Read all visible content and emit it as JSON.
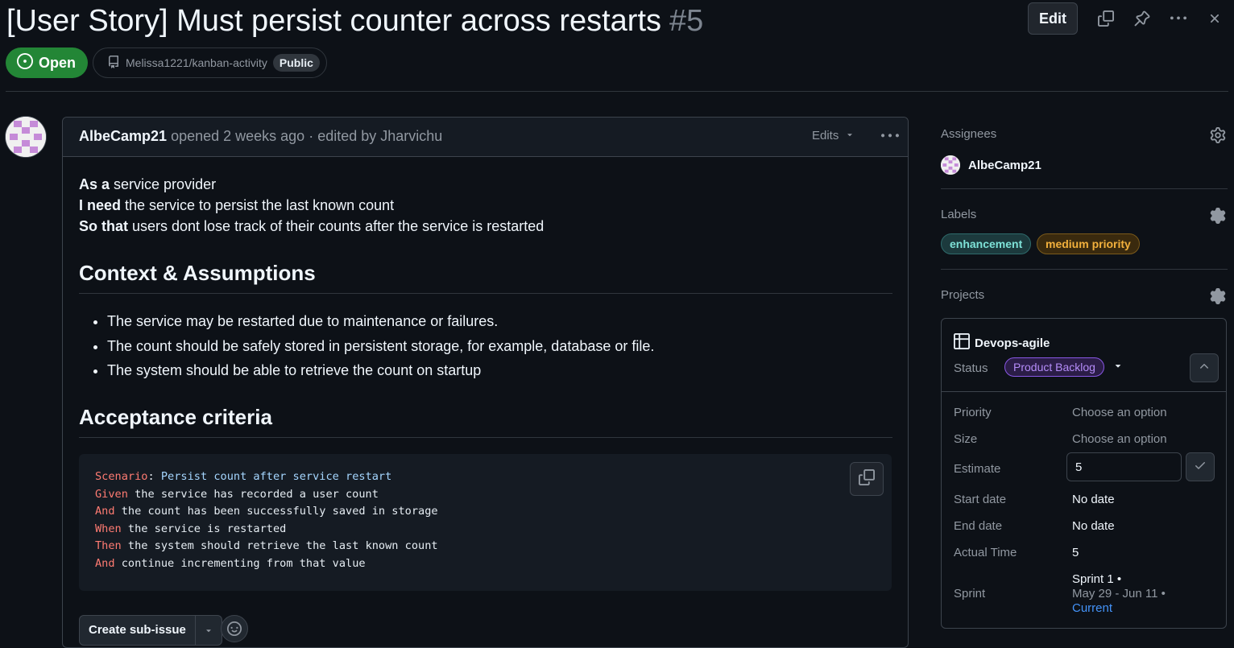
{
  "issue": {
    "title": "[User Story] Must persist counter across restarts",
    "number": "#5",
    "state": "Open",
    "repo": "Melissa1221/kanban-activity",
    "visibility": "Public",
    "edit_label": "Edit"
  },
  "comment": {
    "author": "AlbeCamp21",
    "meta": "opened 2 weeks ago · edited by Jharvichu",
    "edits_label": "Edits",
    "story": [
      {
        "bold": "As a",
        "text": " service provider"
      },
      {
        "bold": "I need",
        "text": " the service to persist the last known count"
      },
      {
        "bold": "So that",
        "text": " users dont lose track of their counts after the service is restarted"
      }
    ],
    "context_heading": "Context & Assumptions",
    "context_items": [
      "The service may be restarted due to maintenance or failures.",
      "The count should be safely stored in persistent storage, for example, database or file.",
      "The system should be able to retrieve the count on startup"
    ],
    "acceptance_heading": "Acceptance criteria",
    "code_lines": [
      {
        "kw": "Scenario",
        "rest": ": ",
        "str": "Persist count after service restart"
      },
      {
        "kw": "Given",
        "rest": " the service has recorded a user count",
        "str": ""
      },
      {
        "kw": "And",
        "rest": " the count has been successfully saved in storage",
        "str": ""
      },
      {
        "kw": "When",
        "rest": " the service is restarted",
        "str": ""
      },
      {
        "kw": "Then",
        "rest": " the system should retrieve the last known count",
        "str": ""
      },
      {
        "kw": "And",
        "rest": " continue incrementing from that value",
        "str": ""
      }
    ],
    "create_subissue_label": "Create sub-issue"
  },
  "sidebar": {
    "assignees_heading": "Assignees",
    "assignee": "AlbeCamp21",
    "labels_heading": "Labels",
    "labels": [
      {
        "name": "enhancement",
        "color": "#7ee2d8",
        "bg": "#1c3a3d",
        "border": "#2e6a6b"
      },
      {
        "name": "medium priority",
        "color": "#f2b03c",
        "bg": "#3a2a0e",
        "border": "#7a5a1b"
      }
    ],
    "projects_heading": "Projects",
    "project": {
      "name": "Devops-agile",
      "status_label": "Status",
      "status_value": "Product Backlog",
      "fields": {
        "priority_label": "Priority",
        "priority_value": "Choose an option",
        "size_label": "Size",
        "size_value": "Choose an option",
        "estimate_label": "Estimate",
        "estimate_value": "5",
        "start_label": "Start date",
        "start_value": "No date",
        "end_label": "End date",
        "end_value": "No date",
        "actual_label": "Actual Time",
        "actual_value": "5",
        "sprint_label": "Sprint",
        "sprint_name": "Sprint 1 •",
        "sprint_range": "May 29 - Jun 11 •",
        "sprint_current": "Current"
      }
    }
  },
  "colors": {
    "background": "#0d1117",
    "open_green": "#238636",
    "status_purple": "#a371f7",
    "link_blue": "#4493f8"
  }
}
